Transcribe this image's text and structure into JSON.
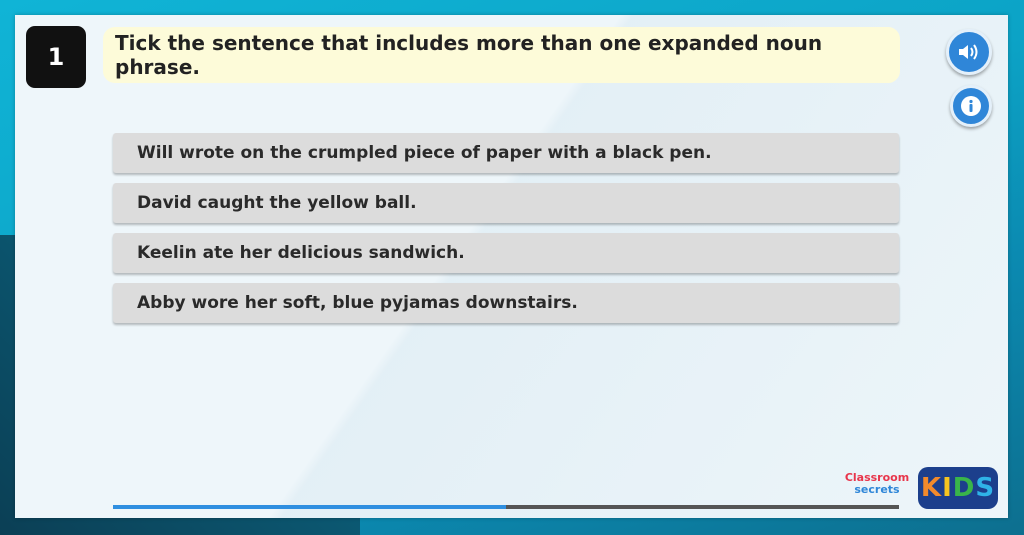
{
  "question": {
    "number": "1",
    "text": "Tick the sentence that includes more than one expanded noun phrase."
  },
  "answers": [
    "Will wrote on the crumpled piece of paper with a black pen.",
    "David caught the yellow ball.",
    "Keelin ate her delicious sandwich.",
    "Abby wore her soft, blue pyjamas downstairs."
  ],
  "icons": {
    "audio": "speaker-icon",
    "info": "info-icon"
  },
  "progress": {
    "fraction": 0.5
  },
  "logo": {
    "classroom": "Classroom",
    "secrets": "secrets",
    "kids_letters": [
      "K",
      "I",
      "D",
      "S"
    ]
  },
  "colors": {
    "background": "#0aa9cc",
    "card": "#eef6fa",
    "question_bg": "#fdfbd9",
    "button_blue": "#2f86d8",
    "answer_bg": "#dcdcdc"
  }
}
